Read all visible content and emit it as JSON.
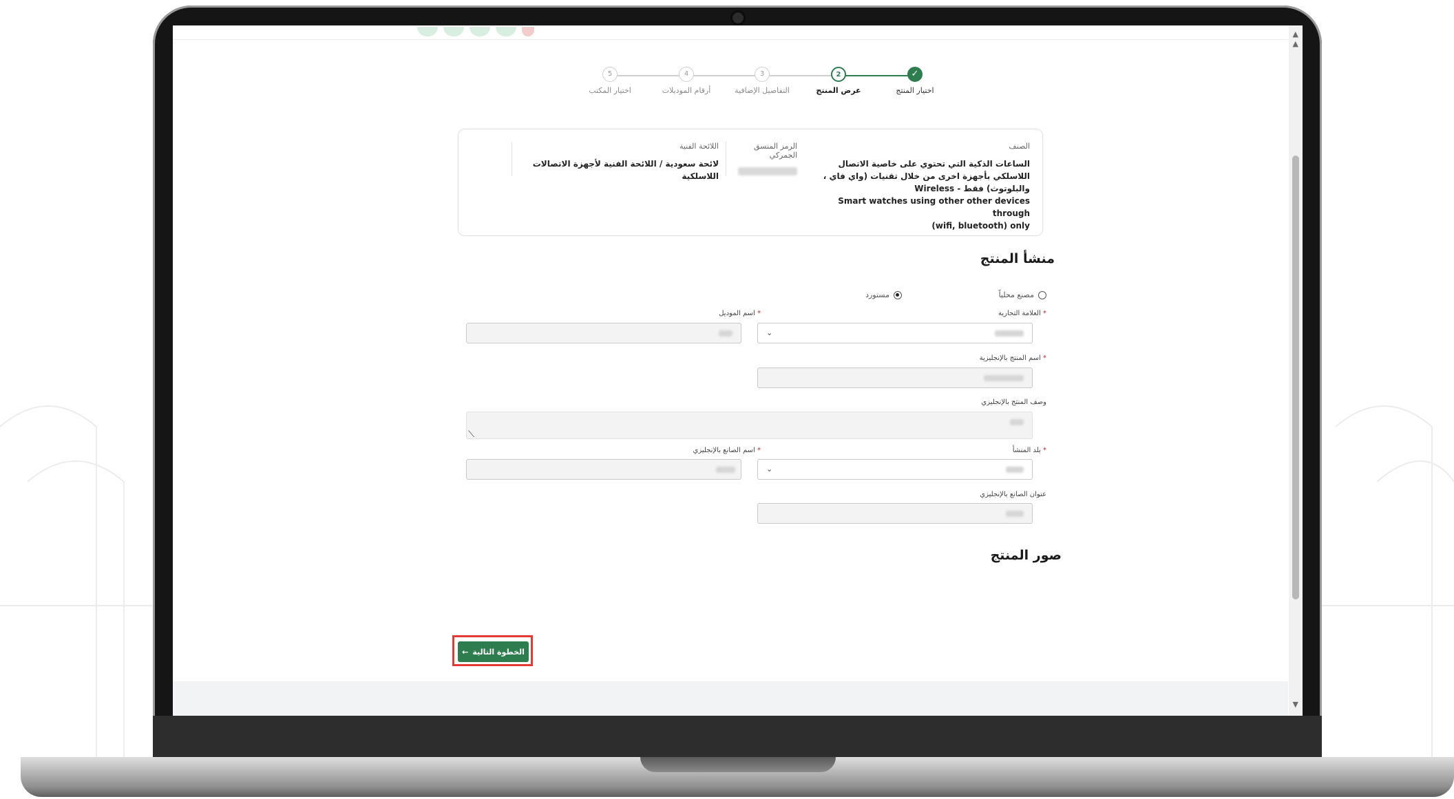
{
  "stepper": {
    "steps": [
      {
        "number": "",
        "label": "اختيار المنتج",
        "state": "done"
      },
      {
        "number": "2",
        "label": "عرض المنتج",
        "state": "active"
      },
      {
        "number": "3",
        "label": "التفاصيل الإضافية",
        "state": "pending"
      },
      {
        "number": "4",
        "label": "أرقام الموديلات",
        "state": "pending"
      },
      {
        "number": "5",
        "label": "اختيار المكتب",
        "state": "pending"
      }
    ],
    "check_icon": "✓"
  },
  "info_card": {
    "class_label": "الصنف",
    "class_value_ar": "الساعات الذكية التي تحتوي على خاصية الاتصال اللاسلكي بأجهزة اخرى من خلال تقنيات (واي فاي ، والبلوتوث) فقط - Wireless",
    "class_value_en1": "Smart watches using other other devices through",
    "class_value_en2": "(wifi, bluetooth) only",
    "hs_code_label": "الرمز المنسق الجمركي",
    "regulation_label": "اللائحة الفنية",
    "regulation_value": "لائحة سعودية / اللائحة الفنية لأجهزة الاتصالات اللاسلكية"
  },
  "origin_section": {
    "title": "منشأ المنتج",
    "radio_local": "مصنع محلياً",
    "radio_imported": "مستورد",
    "selected": "imported",
    "required_mark": "*",
    "brand_label": "العلامة التجارية",
    "model_name_label": "اسم الموديل",
    "product_name_en_label": "اسم المنتج بالإنجليزية",
    "product_desc_en_label": "وصف المنتج بالإنجليزي",
    "origin_country_label": "بلد المنشأ",
    "manufacturer_name_en_label": "اسم الصانع بالإنجليزي",
    "manufacturer_address_en_label": "عنوان الصانع بالإنجليزي"
  },
  "images_section": {
    "title": "صور المنتج"
  },
  "next_button": {
    "label": "الخطوة التالية",
    "arrow": "←"
  },
  "colors": {
    "primary_green": "#2e7d4f",
    "highlight_red": "#e53935"
  }
}
